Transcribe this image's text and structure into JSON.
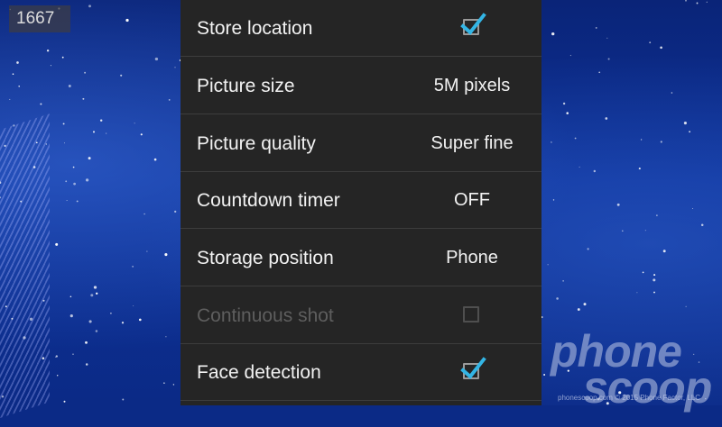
{
  "overlay": {
    "frame_counter": "1667"
  },
  "settings": {
    "rows": [
      {
        "label": "Store location",
        "type": "checkbox",
        "checked": true,
        "enabled": true
      },
      {
        "label": "Picture size",
        "type": "value",
        "value": "5M pixels",
        "enabled": true
      },
      {
        "label": "Picture quality",
        "type": "value",
        "value": "Super fine",
        "enabled": true
      },
      {
        "label": "Countdown timer",
        "type": "value",
        "value": "OFF",
        "enabled": true
      },
      {
        "label": "Storage position",
        "type": "value",
        "value": "Phone",
        "enabled": true
      },
      {
        "label": "Continuous shot",
        "type": "checkbox",
        "checked": false,
        "enabled": false
      },
      {
        "label": "Face detection",
        "type": "checkbox",
        "checked": true,
        "enabled": true
      }
    ]
  },
  "watermark": {
    "line1": "phone",
    "line2": "scoop",
    "credit": "phonescoop.com © 2015 Phone Factor, LLC"
  },
  "colors": {
    "panel_bg": "#252525",
    "text": "#f2f2f2",
    "disabled_text": "#5e5e5e",
    "accent_check": "#33b5e5",
    "divider": "#3d3d3d"
  }
}
